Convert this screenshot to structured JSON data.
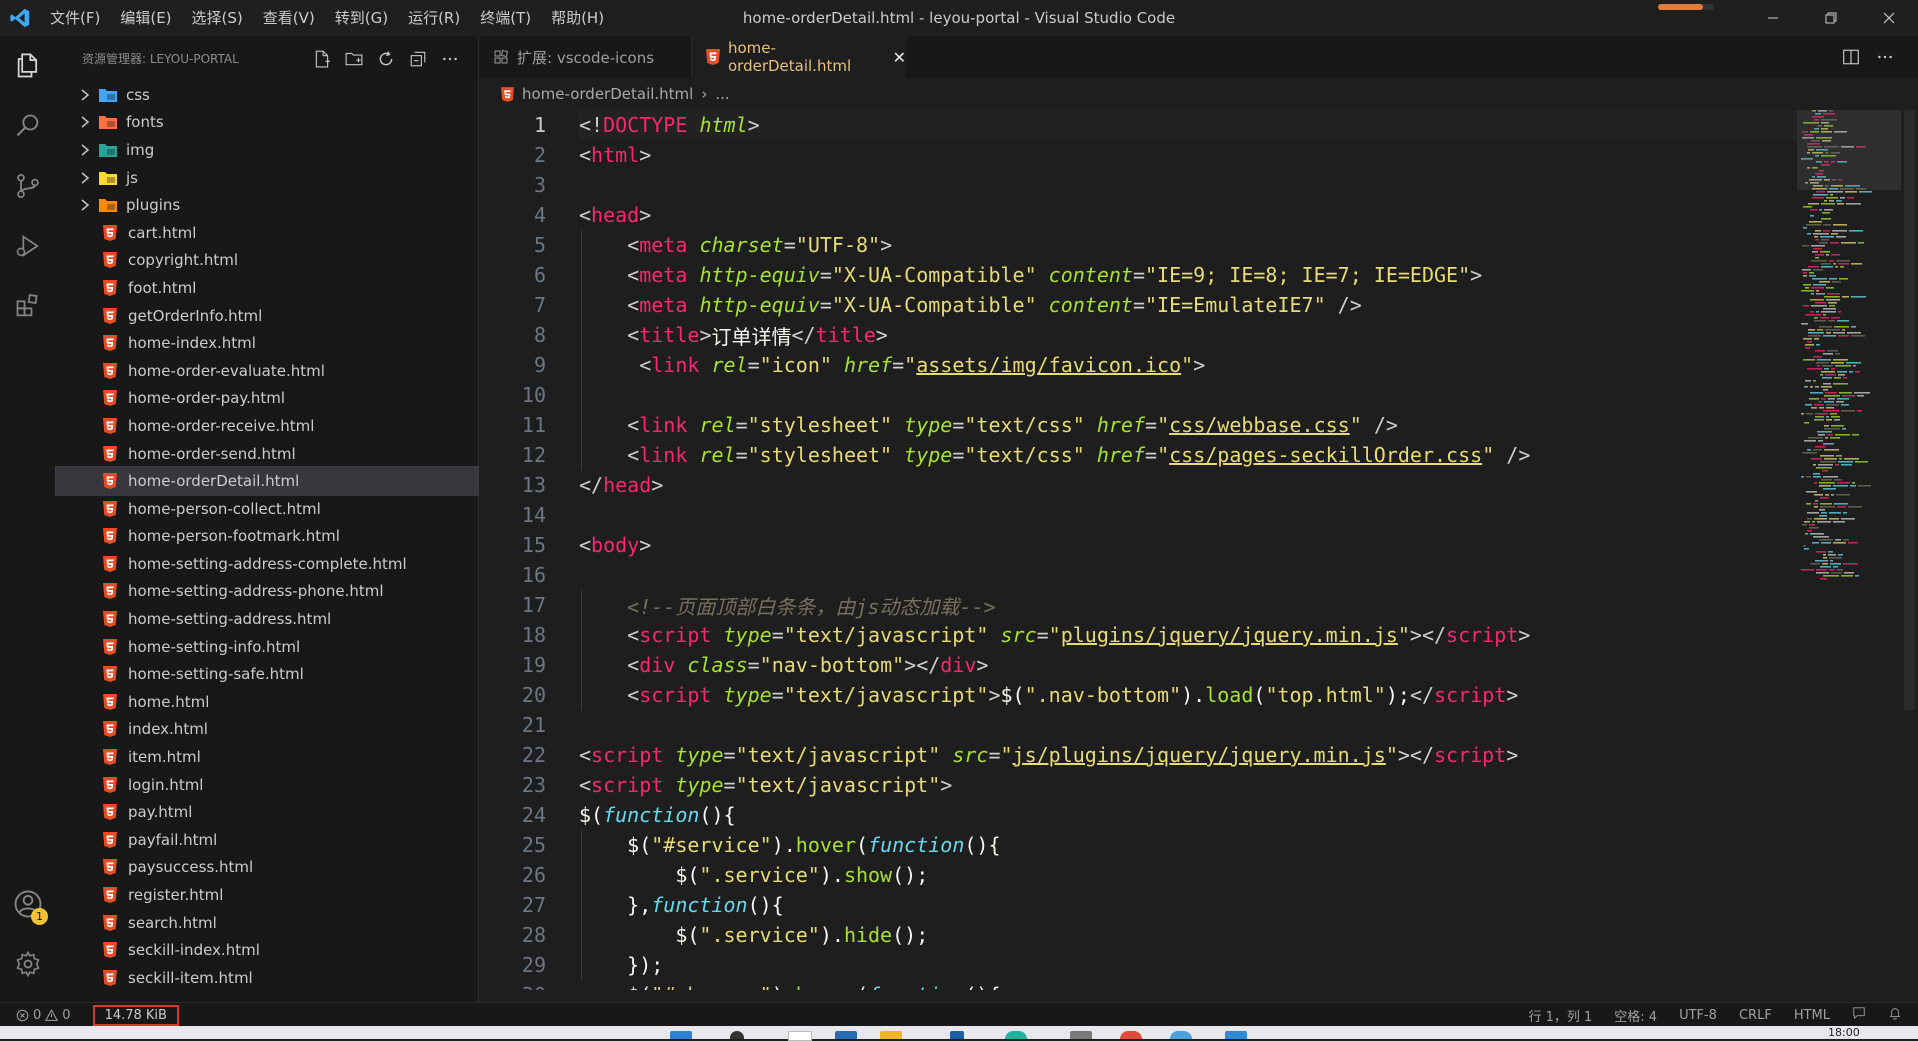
{
  "window": {
    "title": "home-orderDetail.html - leyou-portal - Visual Studio Code",
    "progress": 0.8
  },
  "menu": [
    "文件(F)",
    "编辑(E)",
    "选择(S)",
    "查看(V)",
    "转到(G)",
    "运行(R)",
    "终端(T)",
    "帮助(H)"
  ],
  "activity_bar": {
    "account_badge": "1"
  },
  "explorer": {
    "header": "资源管理器: LEYOU-PORTAL",
    "folders": [
      {
        "name": "css",
        "icon": "css-folder-icon",
        "color": "#42a5f5"
      },
      {
        "name": "fonts",
        "icon": "fonts-folder-icon",
        "color": "#ff7043"
      },
      {
        "name": "img",
        "icon": "images-folder-icon",
        "color": "#26a69a"
      },
      {
        "name": "js",
        "icon": "js-folder-icon",
        "color": "#fdd835"
      },
      {
        "name": "plugins",
        "icon": "plugins-folder-icon",
        "color": "#fb8c00"
      }
    ],
    "files": [
      "cart.html",
      "copyright.html",
      "foot.html",
      "getOrderInfo.html",
      "home-index.html",
      "home-order-evaluate.html",
      "home-order-pay.html",
      "home-order-receive.html",
      "home-order-send.html",
      "home-orderDetail.html",
      "home-person-collect.html",
      "home-person-footmark.html",
      "home-setting-address-complete.html",
      "home-setting-address-phone.html",
      "home-setting-address.html",
      "home-setting-info.html",
      "home-setting-safe.html",
      "home.html",
      "index.html",
      "item.html",
      "login.html",
      "pay.html",
      "payfail.html",
      "paysuccess.html",
      "register.html",
      "search.html",
      "seckill-index.html",
      "seckill-item.html"
    ],
    "selected": "home-orderDetail.html"
  },
  "tabs": {
    "inactive": "扩展: vscode-icons",
    "active": "home-orderDetail.html",
    "close": "✕"
  },
  "breadcrumb": {
    "file": "home-orderDetail.html",
    "sep": "›",
    "rest": "..."
  },
  "editor": {
    "current_line": 1,
    "lines": [
      [
        [
          "<!",
          "pun"
        ],
        [
          "DOCTYPE",
          "tag"
        ],
        [
          " ",
          "txt"
        ],
        [
          "html",
          "attr"
        ],
        [
          ">",
          "pun"
        ]
      ],
      [
        [
          "<",
          "pun"
        ],
        [
          "html",
          "tag"
        ],
        [
          ">",
          "pun"
        ]
      ],
      [],
      [
        [
          "<",
          "pun"
        ],
        [
          "head",
          "tag"
        ],
        [
          ">",
          "pun"
        ]
      ],
      [
        [
          "    ",
          "txt"
        ],
        [
          "<",
          "pun"
        ],
        [
          "meta",
          "tag"
        ],
        [
          " ",
          "txt"
        ],
        [
          "charset",
          "attr"
        ],
        [
          "=",
          "pun"
        ],
        [
          "\"UTF-8\"",
          "str"
        ],
        [
          ">",
          "pun"
        ]
      ],
      [
        [
          "    ",
          "txt"
        ],
        [
          "<",
          "pun"
        ],
        [
          "meta",
          "tag"
        ],
        [
          " ",
          "txt"
        ],
        [
          "http-equiv",
          "attr"
        ],
        [
          "=",
          "pun"
        ],
        [
          "\"X-UA-Compatible\"",
          "str"
        ],
        [
          " ",
          "txt"
        ],
        [
          "content",
          "attr"
        ],
        [
          "=",
          "pun"
        ],
        [
          "\"IE=9; IE=8; IE=7; IE=EDGE\"",
          "str"
        ],
        [
          ">",
          "pun"
        ]
      ],
      [
        [
          "    ",
          "txt"
        ],
        [
          "<",
          "pun"
        ],
        [
          "meta",
          "tag"
        ],
        [
          " ",
          "txt"
        ],
        [
          "http-equiv",
          "attr"
        ],
        [
          "=",
          "pun"
        ],
        [
          "\"X-UA-Compatible\"",
          "str"
        ],
        [
          " ",
          "txt"
        ],
        [
          "content",
          "attr"
        ],
        [
          "=",
          "pun"
        ],
        [
          "\"IE=EmulateIE7\"",
          "str"
        ],
        [
          " />",
          "pun"
        ]
      ],
      [
        [
          "    ",
          "txt"
        ],
        [
          "<",
          "pun"
        ],
        [
          "title",
          "tag"
        ],
        [
          ">",
          "pun"
        ],
        [
          "订单详情",
          "txt"
        ],
        [
          "</",
          "pun"
        ],
        [
          "title",
          "tag"
        ],
        [
          ">",
          "pun"
        ]
      ],
      [
        [
          "     ",
          "txt"
        ],
        [
          "<",
          "pun"
        ],
        [
          "link",
          "tag"
        ],
        [
          " ",
          "txt"
        ],
        [
          "rel",
          "attr"
        ],
        [
          "=",
          "pun"
        ],
        [
          "\"icon\"",
          "str"
        ],
        [
          " ",
          "txt"
        ],
        [
          "href",
          "attr"
        ],
        [
          "=",
          "pun"
        ],
        [
          "\"",
          "str"
        ],
        [
          "assets/img/favicon.ico",
          "link"
        ],
        [
          "\"",
          "str"
        ],
        [
          ">",
          "pun"
        ]
      ],
      [],
      [
        [
          "    ",
          "txt"
        ],
        [
          "<",
          "pun"
        ],
        [
          "link",
          "tag"
        ],
        [
          " ",
          "txt"
        ],
        [
          "rel",
          "attr"
        ],
        [
          "=",
          "pun"
        ],
        [
          "\"stylesheet\"",
          "str"
        ],
        [
          " ",
          "txt"
        ],
        [
          "type",
          "attr"
        ],
        [
          "=",
          "pun"
        ],
        [
          "\"text/css\"",
          "str"
        ],
        [
          " ",
          "txt"
        ],
        [
          "href",
          "attr"
        ],
        [
          "=",
          "pun"
        ],
        [
          "\"",
          "str"
        ],
        [
          "css/webbase.css",
          "link"
        ],
        [
          "\"",
          "str"
        ],
        [
          " />",
          "pun"
        ]
      ],
      [
        [
          "    ",
          "txt"
        ],
        [
          "<",
          "pun"
        ],
        [
          "link",
          "tag"
        ],
        [
          " ",
          "txt"
        ],
        [
          "rel",
          "attr"
        ],
        [
          "=",
          "pun"
        ],
        [
          "\"stylesheet\"",
          "str"
        ],
        [
          " ",
          "txt"
        ],
        [
          "type",
          "attr"
        ],
        [
          "=",
          "pun"
        ],
        [
          "\"text/css\"",
          "str"
        ],
        [
          " ",
          "txt"
        ],
        [
          "href",
          "attr"
        ],
        [
          "=",
          "pun"
        ],
        [
          "\"",
          "str"
        ],
        [
          "css/pages-seckillOrder.css",
          "link"
        ],
        [
          "\"",
          "str"
        ],
        [
          " />",
          "pun"
        ]
      ],
      [
        [
          "</",
          "pun"
        ],
        [
          "head",
          "tag"
        ],
        [
          ">",
          "pun"
        ]
      ],
      [],
      [
        [
          "<",
          "pun"
        ],
        [
          "body",
          "tag"
        ],
        [
          ">",
          "pun"
        ]
      ],
      [],
      [
        [
          "    ",
          "txt"
        ],
        [
          "<!--页面顶部白条条，由js动态加载-->",
          "com"
        ]
      ],
      [
        [
          "    ",
          "txt"
        ],
        [
          "<",
          "pun"
        ],
        [
          "script",
          "tag"
        ],
        [
          " ",
          "txt"
        ],
        [
          "type",
          "attr"
        ],
        [
          "=",
          "pun"
        ],
        [
          "\"text/javascript\"",
          "str"
        ],
        [
          " ",
          "txt"
        ],
        [
          "src",
          "attr"
        ],
        [
          "=",
          "pun"
        ],
        [
          "\"",
          "str"
        ],
        [
          "plugins/jquery/jquery.min.js",
          "link"
        ],
        [
          "\"",
          "str"
        ],
        [
          "></",
          "pun"
        ],
        [
          "script",
          "tag"
        ],
        [
          ">",
          "pun"
        ]
      ],
      [
        [
          "    ",
          "txt"
        ],
        [
          "<",
          "pun"
        ],
        [
          "div",
          "tag"
        ],
        [
          " ",
          "txt"
        ],
        [
          "class",
          "attr"
        ],
        [
          "=",
          "pun"
        ],
        [
          "\"nav-bottom\"",
          "str"
        ],
        [
          "></",
          "pun"
        ],
        [
          "div",
          "tag"
        ],
        [
          ">",
          "pun"
        ]
      ],
      [
        [
          "    ",
          "txt"
        ],
        [
          "<",
          "pun"
        ],
        [
          "script",
          "tag"
        ],
        [
          " ",
          "txt"
        ],
        [
          "type",
          "attr"
        ],
        [
          "=",
          "pun"
        ],
        [
          "\"text/javascript\"",
          "str"
        ],
        [
          ">",
          "pun"
        ],
        [
          "$(",
          "txt"
        ],
        [
          "\".nav-bottom\"",
          "str"
        ],
        [
          ").",
          "txt"
        ],
        [
          "load",
          "fn"
        ],
        [
          "(",
          "txt"
        ],
        [
          "\"top.html\"",
          "str"
        ],
        [
          ");",
          "txt"
        ],
        [
          "</",
          "pun"
        ],
        [
          "script",
          "tag"
        ],
        [
          ">",
          "pun"
        ]
      ],
      [],
      [
        [
          "<",
          "pun"
        ],
        [
          "script",
          "tag"
        ],
        [
          " ",
          "txt"
        ],
        [
          "type",
          "attr"
        ],
        [
          "=",
          "pun"
        ],
        [
          "\"text/javascript\"",
          "str"
        ],
        [
          " ",
          "txt"
        ],
        [
          "src",
          "attr"
        ],
        [
          "=",
          "pun"
        ],
        [
          "\"",
          "str"
        ],
        [
          "js/plugins/jquery/jquery.min.js",
          "link"
        ],
        [
          "\"",
          "str"
        ],
        [
          "></",
          "pun"
        ],
        [
          "script",
          "tag"
        ],
        [
          ">",
          "pun"
        ]
      ],
      [
        [
          "<",
          "pun"
        ],
        [
          "script",
          "tag"
        ],
        [
          " ",
          "txt"
        ],
        [
          "type",
          "attr"
        ],
        [
          "=",
          "pun"
        ],
        [
          "\"text/javascript\"",
          "str"
        ],
        [
          ">",
          "pun"
        ]
      ],
      [
        [
          "$(",
          "txt"
        ],
        [
          "function",
          "kw"
        ],
        [
          "(){",
          "txt"
        ]
      ],
      [
        [
          "    ",
          "txt"
        ],
        [
          "$(",
          "txt"
        ],
        [
          "\"#service\"",
          "str"
        ],
        [
          ").",
          "txt"
        ],
        [
          "hover",
          "fn"
        ],
        [
          "(",
          "txt"
        ],
        [
          "function",
          "kw"
        ],
        [
          "(){",
          "txt"
        ]
      ],
      [
        [
          "        ",
          "txt"
        ],
        [
          "$(",
          "txt"
        ],
        [
          "\".service\"",
          "str"
        ],
        [
          ").",
          "txt"
        ],
        [
          "show",
          "fn"
        ],
        [
          "();",
          "txt"
        ]
      ],
      [
        [
          "    ",
          "txt"
        ],
        [
          "},",
          "txt"
        ],
        [
          "function",
          "kw"
        ],
        [
          "(){",
          "txt"
        ]
      ],
      [
        [
          "        ",
          "txt"
        ],
        [
          "$(",
          "txt"
        ],
        [
          "\".service\"",
          "str"
        ],
        [
          ").",
          "txt"
        ],
        [
          "hide",
          "fn"
        ],
        [
          "();",
          "txt"
        ]
      ],
      [
        [
          "    ",
          "txt"
        ],
        [
          "});",
          "txt"
        ]
      ],
      [
        [
          "    ",
          "txt"
        ],
        [
          "$(",
          "txt"
        ],
        [
          "\"#shopcar\"",
          "str"
        ],
        [
          ").",
          "txt"
        ],
        [
          "hover",
          "fn"
        ],
        [
          "(",
          "txt"
        ],
        [
          "function",
          "kw"
        ],
        [
          "(){",
          "txt"
        ]
      ]
    ]
  },
  "status": {
    "errors": "0",
    "warnings": "0",
    "file_size": "14.78 KiB",
    "position": "行 1，列 1",
    "spaces": "空格: 4",
    "encoding": "UTF-8",
    "eol": "CRLF",
    "language": "HTML"
  },
  "taskbar": {
    "time": "18:00"
  }
}
